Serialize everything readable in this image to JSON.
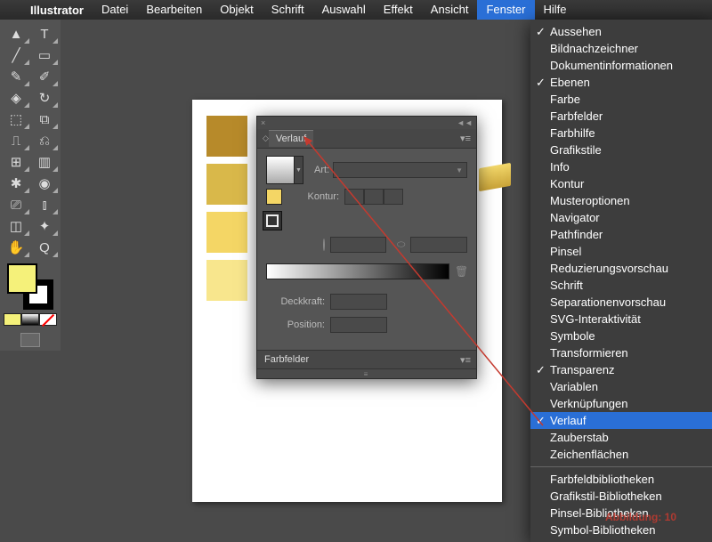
{
  "menubar": {
    "app": "Illustrator",
    "items": [
      "Datei",
      "Bearbeiten",
      "Objekt",
      "Schrift",
      "Auswahl",
      "Effekt",
      "Ansicht",
      "Fenster",
      "Hilfe"
    ],
    "open_index": 7
  },
  "dropdown": {
    "groups": [
      [
        {
          "label": "Aussehen",
          "checked": true
        },
        {
          "label": "Bildnachzeichner",
          "checked": false
        },
        {
          "label": "Dokumentinformationen",
          "checked": false
        },
        {
          "label": "Ebenen",
          "checked": true
        },
        {
          "label": "Farbe",
          "checked": false
        },
        {
          "label": "Farbfelder",
          "checked": false
        },
        {
          "label": "Farbhilfe",
          "checked": false
        },
        {
          "label": "Grafikstile",
          "checked": false
        },
        {
          "label": "Info",
          "checked": false
        },
        {
          "label": "Kontur",
          "checked": false
        },
        {
          "label": "Musteroptionen",
          "checked": false
        },
        {
          "label": "Navigator",
          "checked": false
        },
        {
          "label": "Pathfinder",
          "checked": false
        },
        {
          "label": "Pinsel",
          "checked": false
        },
        {
          "label": "Reduzierungsvorschau",
          "checked": false
        },
        {
          "label": "Schrift",
          "checked": false
        },
        {
          "label": "Separationenvorschau",
          "checked": false
        },
        {
          "label": "SVG-Interaktivität",
          "checked": false
        },
        {
          "label": "Symbole",
          "checked": false
        },
        {
          "label": "Transformieren",
          "checked": false
        },
        {
          "label": "Transparenz",
          "checked": true
        },
        {
          "label": "Variablen",
          "checked": false
        },
        {
          "label": "Verknüpfungen",
          "checked": false
        },
        {
          "label": "Verlauf",
          "checked": true,
          "highlight": true
        },
        {
          "label": "Zauberstab",
          "checked": false
        },
        {
          "label": "Zeichenflächen",
          "checked": false
        }
      ],
      [
        {
          "label": "Farbfeldbibliotheken",
          "checked": false
        },
        {
          "label": "Grafikstil-Bibliotheken",
          "checked": false
        },
        {
          "label": "Pinsel-Bibliotheken",
          "checked": false
        },
        {
          "label": "Symbol-Bibliotheken",
          "checked": false
        }
      ]
    ]
  },
  "panel": {
    "tab_verlauf": "Verlauf",
    "tab_farbfelder": "Farbfelder",
    "label_art": "Art:",
    "label_kontur": "Kontur:",
    "label_deckkraft": "Deckkraft:",
    "label_position": "Position:",
    "close_glyph": "×",
    "collapse_glyph": "◄◄"
  },
  "swatches": {
    "colors": [
      "#b78a2a",
      "#d9b84a",
      "#f4d665",
      "#f8e68d"
    ]
  },
  "watermark": "Abbildung: 10",
  "tool_glyphs": [
    [
      "▲",
      "T"
    ],
    [
      "╱",
      "▭"
    ],
    [
      "✎",
      "◈"
    ],
    [
      "✂",
      "↻"
    ],
    [
      "⬚",
      "⧉"
    ],
    [
      "⎍",
      "⎌"
    ],
    [
      "⊞",
      "⌗"
    ],
    [
      "✱",
      "◉"
    ],
    [
      "⎚",
      "⚲"
    ],
    [
      "◫",
      "✦"
    ],
    [
      "▦",
      "⤢"
    ],
    [
      "✋",
      "Q"
    ]
  ]
}
